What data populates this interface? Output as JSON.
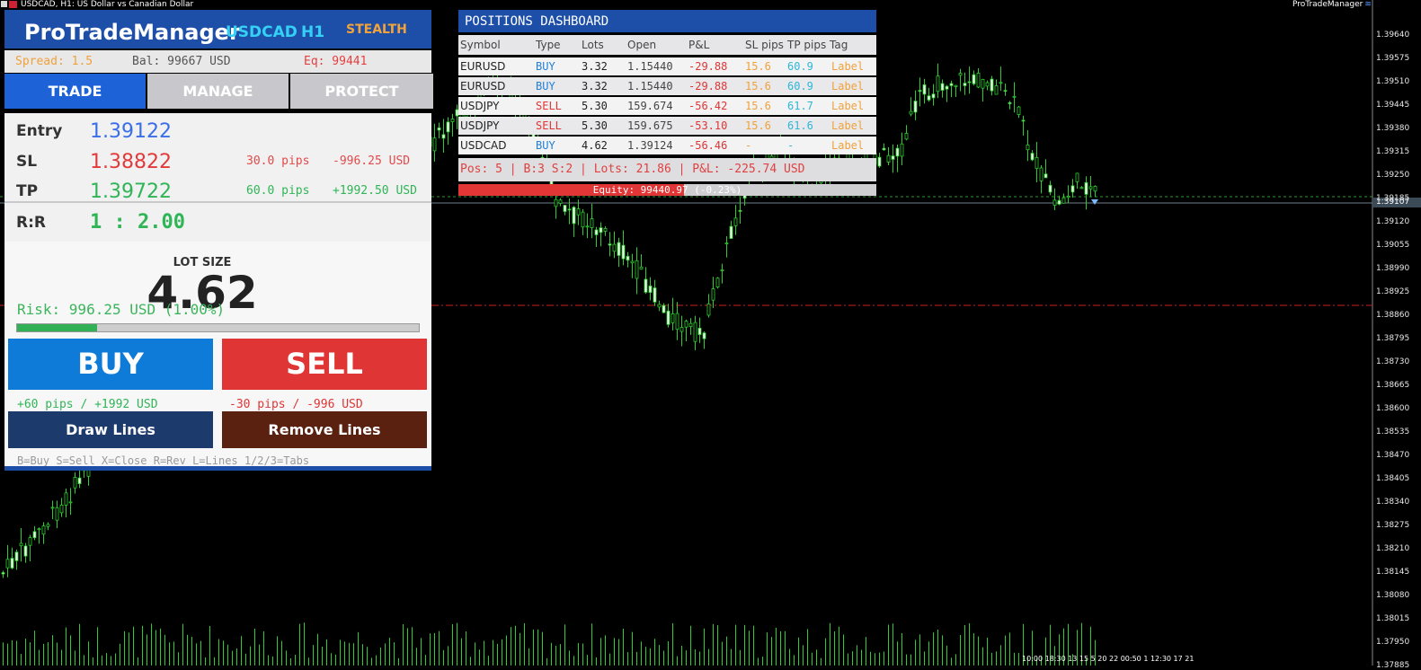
{
  "window": {
    "title": "USDCAD, H1:  US Dollar vs Canadian Dollar",
    "indicator_name": "ProTradeManager"
  },
  "axis": {
    "prices": [
      "1.39640",
      "1.39575",
      "1.39510",
      "1.39445",
      "1.39380",
      "1.39315",
      "1.39250",
      "1.39185",
      "1.39120",
      "1.39055",
      "1.38990",
      "1.38925",
      "1.38860",
      "1.38795",
      "1.38730",
      "1.38665",
      "1.38600",
      "1.38535",
      "1.38470",
      "1.38405",
      "1.38340",
      "1.38275",
      "1.38210",
      "1.38145",
      "1.38080",
      "1.38015",
      "1.37950",
      "1.37885"
    ],
    "current_price": "1.39107",
    "time_labels": "10:00  18:30           13 15 5 20 22 00:50   1 12:30  17 21"
  },
  "panel": {
    "brand": "ProTradeManager",
    "symbol": "USDCAD",
    "timeframe": "H1",
    "mode": "STEALTH",
    "spread": "Spread: 1.5",
    "balance": "Bal: 99667 USD",
    "equity": "Eq: 99441",
    "tabs": {
      "trade": "TRADE",
      "manage": "MANAGE",
      "protect": "PROTECT"
    },
    "entry": {
      "label": "Entry",
      "value": "1.39122"
    },
    "sl": {
      "label": "SL",
      "value": "1.38822",
      "pips": "30.0 pips",
      "amount": "-996.25 USD"
    },
    "tp": {
      "label": "TP",
      "value": "1.39722",
      "pips": "60.0 pips",
      "amount": "+1992.50 USD"
    },
    "rr": {
      "label": "R:R",
      "value": "1 : 2.00"
    },
    "lot_title": "LOT SIZE",
    "lot_value": "4.62",
    "risk_text": "Risk: 996.25 USD  (1.00%)",
    "risk_fraction": 0.2,
    "buy_label": "BUY",
    "sell_label": "SELL",
    "buy_target": "+60 pips / +1992 USD",
    "sell_target": "-30 pips / -996 USD",
    "draw_label": "Draw Lines",
    "remove_label": "Remove Lines",
    "hotkeys": "B=Buy  S=Sell  X=Close  R=Rev  L=Lines  1/2/3=Tabs",
    "colors": {
      "header": "#1e4fa8",
      "buy": "#0f7bd9",
      "sell": "#e03535"
    }
  },
  "dashboard": {
    "title": "POSITIONS DASHBOARD",
    "columns": [
      "Symbol",
      "Type",
      "Lots",
      "Open",
      "P&L",
      "SL pips",
      "TP pips",
      "Tag"
    ],
    "rows": [
      {
        "symbol": "EURUSD",
        "type": "BUY",
        "lots": "3.32",
        "open": "1.15440",
        "pnl": "-29.88",
        "sl": "15.6",
        "tp": "60.9",
        "tag": "Label"
      },
      {
        "symbol": "EURUSD",
        "type": "BUY",
        "lots": "3.32",
        "open": "1.15440",
        "pnl": "-29.88",
        "sl": "15.6",
        "tp": "60.9",
        "tag": "Label"
      },
      {
        "symbol": "USDJPY",
        "type": "SELL",
        "lots": "5.30",
        "open": "159.674",
        "pnl": "-56.42",
        "sl": "15.6",
        "tp": "61.7",
        "tag": "Label"
      },
      {
        "symbol": "USDJPY",
        "type": "SELL",
        "lots": "5.30",
        "open": "159.675",
        "pnl": "-53.10",
        "sl": "15.6",
        "tp": "61.6",
        "tag": "Label"
      },
      {
        "symbol": "USDCAD",
        "type": "BUY",
        "lots": "4.62",
        "open": "1.39124",
        "pnl": "-56.46",
        "sl": "-",
        "tp": "-",
        "tag": "Label"
      }
    ],
    "summary": "Pos: 5  |  B:3  S:2  |  Lots: 21.86  |  P&L: -225.74 USD",
    "equity_text": "Equity: 99440.97 (-0.23%)",
    "equity_fraction": 0.54
  }
}
